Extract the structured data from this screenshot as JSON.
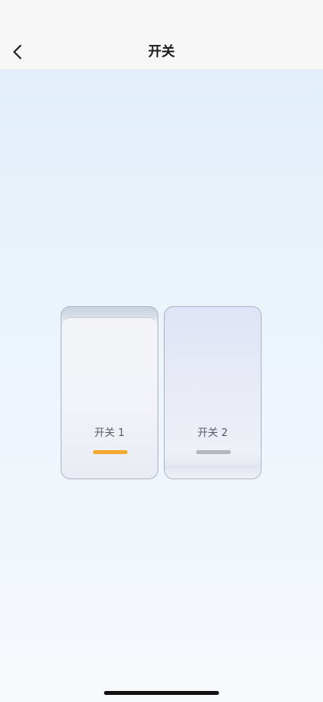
{
  "header": {
    "title": "开关",
    "back_icon": "chevron-left-icon"
  },
  "switches": [
    {
      "label": "开关 1",
      "state": "on",
      "indicator_color": "#f0a92c"
    },
    {
      "label": "开关 2",
      "state": "off",
      "indicator_color": "#b4b6b8"
    }
  ]
}
